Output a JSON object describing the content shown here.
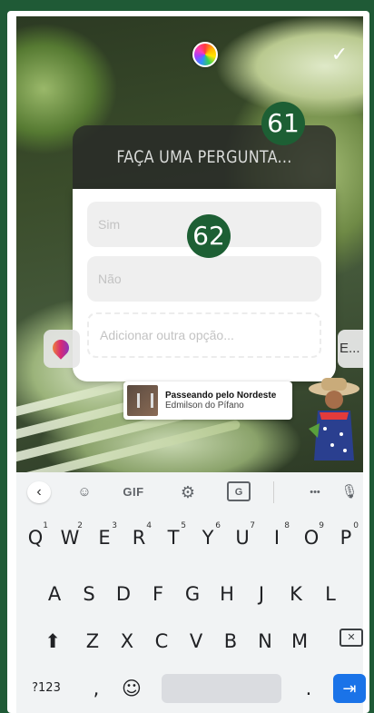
{
  "story": {
    "question_placeholder": "FAÇA UMA PERGUNTA...",
    "options": [
      "Sim",
      "Não"
    ],
    "add_option": "Adicionar outra opção...",
    "right_pill_text": "E...",
    "music": {
      "title": "Passeando pelo Nordeste",
      "artist": "Edmilson do Pífano"
    }
  },
  "badges": [
    "61",
    "62"
  ],
  "keyboard": {
    "toolbar": {
      "back": "‹",
      "sticker": "☺",
      "gif": "GIF",
      "settings": "⚙",
      "translate": "G",
      "more": "•••",
      "mic": "🎙"
    },
    "row1": [
      {
        "k": "Q",
        "n": "1"
      },
      {
        "k": "W",
        "n": "2"
      },
      {
        "k": "E",
        "n": "3"
      },
      {
        "k": "R",
        "n": "4"
      },
      {
        "k": "T",
        "n": "5"
      },
      {
        "k": "Y",
        "n": "6"
      },
      {
        "k": "U",
        "n": "7"
      },
      {
        "k": "I",
        "n": "8"
      },
      {
        "k": "O",
        "n": "9"
      },
      {
        "k": "P",
        "n": "0"
      }
    ],
    "row2": [
      "A",
      "S",
      "D",
      "F",
      "G",
      "H",
      "J",
      "K",
      "L"
    ],
    "row3": [
      "Z",
      "X",
      "C",
      "V",
      "B",
      "N",
      "M"
    ],
    "shift": "⬆",
    "backspace": "✕",
    "symbols": "?123",
    "comma": ",",
    "emoji": "☺",
    "period": ".",
    "enter": "⇥"
  }
}
